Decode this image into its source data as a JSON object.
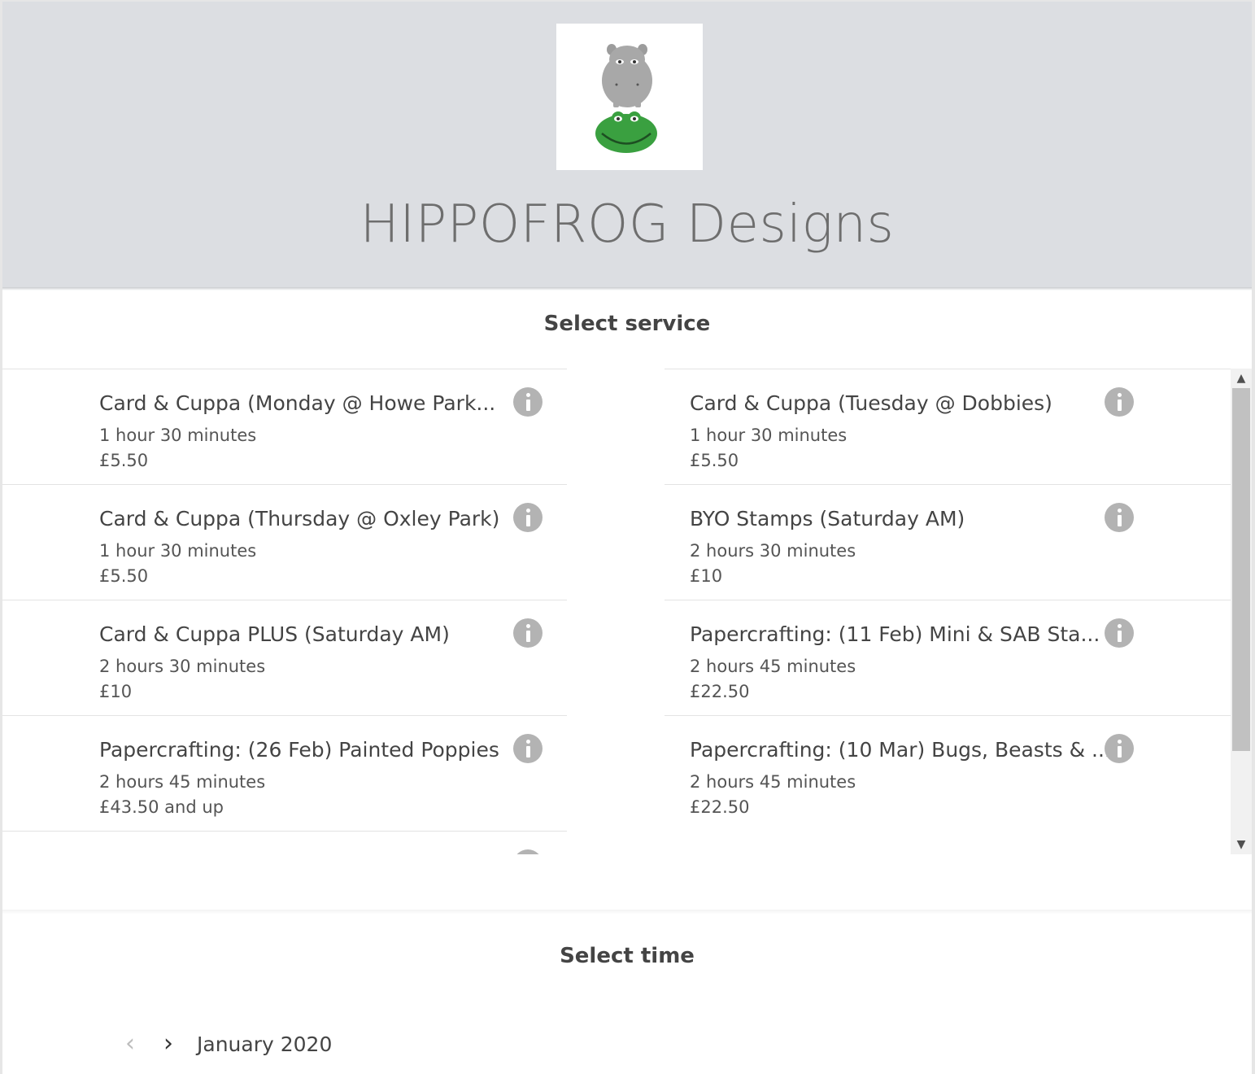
{
  "site": {
    "title": "HIPPOFROG Designs",
    "logo_icon": "hippo-frog-logo"
  },
  "services_section": {
    "title": "Select service",
    "items": [
      {
        "name": "Card & Cuppa (Monday @ Howe Park...",
        "duration": "1 hour 30 minutes",
        "price": "£5.50"
      },
      {
        "name": "Card & Cuppa (Tuesday @ Dobbies)",
        "duration": "1 hour 30 minutes",
        "price": "£5.50"
      },
      {
        "name": "Card & Cuppa (Thursday @ Oxley Park)",
        "duration": "1 hour 30 minutes",
        "price": "£5.50"
      },
      {
        "name": "BYO Stamps (Saturday AM)",
        "duration": "2 hours 30 minutes",
        "price": "£10"
      },
      {
        "name": "Card & Cuppa PLUS (Saturday AM)",
        "duration": "2 hours 30 minutes",
        "price": "£10"
      },
      {
        "name": "Papercrafting: (11 Feb) Mini & SAB Sta...",
        "duration": "2 hours 45 minutes",
        "price": "£22.50"
      },
      {
        "name": "Papercrafting: (26 Feb) Painted Poppies",
        "duration": "2 hours 45 minutes",
        "price": "£43.50 and up"
      },
      {
        "name": "Papercrafting: (10 Mar) Bugs, Beasts & ...",
        "duration": "2 hours 45 minutes",
        "price": "£22.50"
      }
    ]
  },
  "scrollbar": {
    "up_icon": "▲",
    "down_icon": "▼"
  },
  "time_section": {
    "title": "Select time",
    "prev_icon": "‹",
    "next_icon": "›",
    "month": "January 2020"
  },
  "colors": {
    "header_bg": "#dcdee2",
    "info_icon": "#b3b3b3",
    "frog_green": "#3aa040",
    "hippo_gray": "#a8a8a8"
  }
}
